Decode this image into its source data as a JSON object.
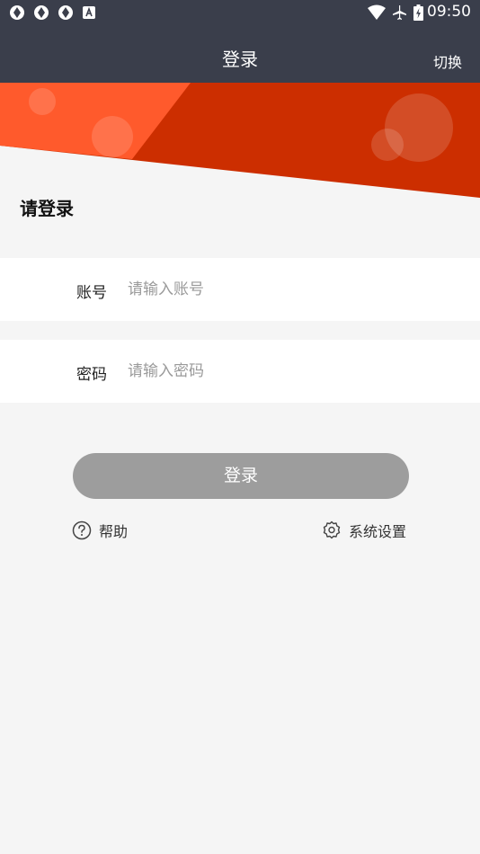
{
  "status_bar": {
    "time": "09:50",
    "left_icons": [
      "app-icon",
      "app-icon",
      "app-icon",
      "a-badge-icon"
    ],
    "right_icons": [
      "wifi-icon",
      "airplane-icon",
      "battery-icon"
    ]
  },
  "app_bar": {
    "title": "登录",
    "switch_label": "切换"
  },
  "banner": {
    "colors": {
      "light": "#ff5a2c",
      "dark": "#cc2e00"
    }
  },
  "login": {
    "heading": "请登录",
    "account": {
      "label": "账号",
      "placeholder": "请输入账号",
      "value": ""
    },
    "password": {
      "label": "密码",
      "placeholder": "请输入密码",
      "value": ""
    },
    "submit_label": "登录",
    "help_label": "帮助",
    "settings_label": "系统设置"
  },
  "colors": {
    "app_bar": "#3a3e4b",
    "button_disabled": "#9d9d9d",
    "background": "#f5f5f5"
  }
}
